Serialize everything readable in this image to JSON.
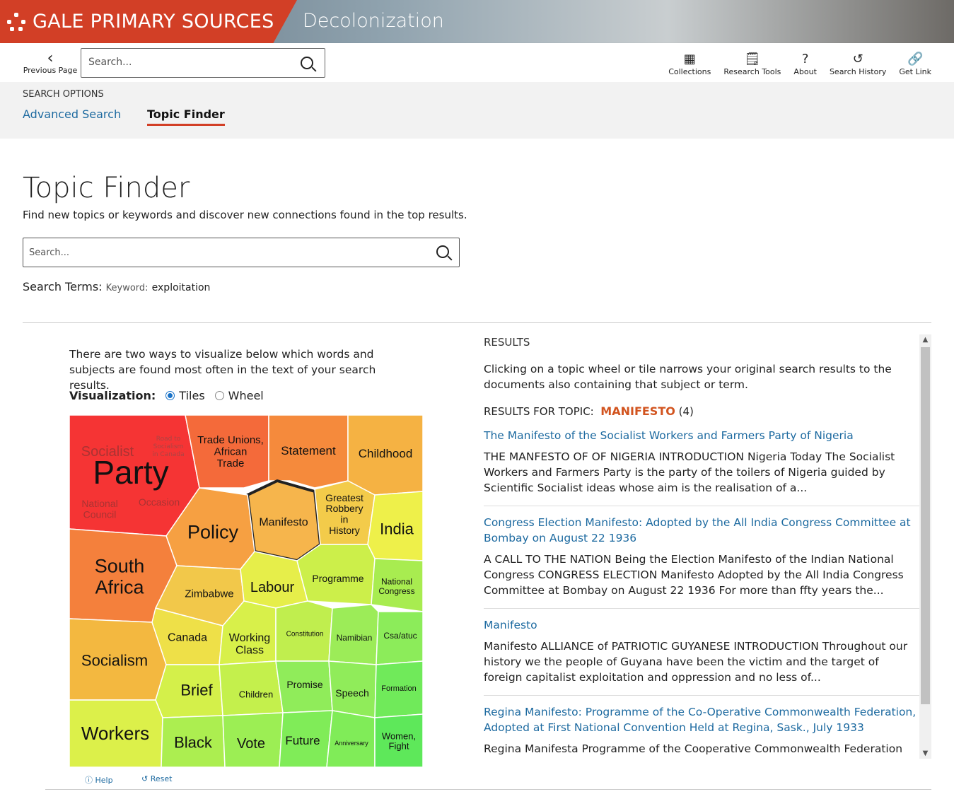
{
  "header": {
    "brand": "GALE PRIMARY SOURCES",
    "collection": "Decolonization"
  },
  "toolbar": {
    "previous": "Previous Page",
    "search_placeholder": "Search...",
    "tools": [
      {
        "label": "Collections",
        "icon": "grid-icon"
      },
      {
        "label": "Research Tools",
        "icon": "notebook-icon"
      },
      {
        "label": "About",
        "icon": "question-icon"
      },
      {
        "label": "Search History",
        "icon": "history-icon"
      },
      {
        "label": "Get Link",
        "icon": "link-icon"
      }
    ]
  },
  "search_options": {
    "label": "SEARCH OPTIONS",
    "advanced": "Advanced Search",
    "topic_finder": "Topic Finder"
  },
  "page": {
    "title": "Topic Finder",
    "subtitle": "Find new topics or keywords and discover new connections found in the top results.",
    "search_placeholder": "Search...",
    "terms_label": "Search Terms:",
    "keyword_label": "Keyword:",
    "keyword_value": "exploitation"
  },
  "viz": {
    "intro": "There are two ways to visualize below which words and subjects are found most often in the text of your search results.",
    "label": "Visualization:",
    "options": [
      "Tiles",
      "Wheel"
    ],
    "selected": "Tiles",
    "help": "Help",
    "reset": "Reset",
    "selected_tile": "Manifesto"
  },
  "tiles": [
    {
      "label": "Trade Unions, African Trade",
      "color": "#f46a3a"
    },
    {
      "label": "Statement",
      "color": "#f58a3c"
    },
    {
      "label": "Childhood",
      "color": "#f5b243"
    },
    {
      "label": "Manifesto",
      "color": "#f6b54c"
    },
    {
      "label": "Greatest Robbery in History",
      "color": "#f3cb4a"
    },
    {
      "label": "India",
      "color": "#eef04a"
    },
    {
      "label": "Policy",
      "color": "#f6a042"
    },
    {
      "label": "South Africa",
      "color": "#f4803c"
    },
    {
      "label": "Zimbabwe",
      "color": "#f2c84a"
    },
    {
      "label": "Labour",
      "color": "#e6ee4a"
    },
    {
      "label": "Programme",
      "color": "#ccef4a"
    },
    {
      "label": "National Congress",
      "color": "#a8ec50"
    },
    {
      "label": "Socialism",
      "color": "#f3b840"
    },
    {
      "label": "Canada",
      "color": "#eee048"
    },
    {
      "label": "Working Class",
      "color": "#d8f04a"
    },
    {
      "label": "Constitution",
      "color": "#c0ee4e"
    },
    {
      "label": "Namibian",
      "color": "#9cec58"
    },
    {
      "label": "Csa/atuc",
      "color": "#8cec5a"
    },
    {
      "label": "Brief",
      "color": "#d4f04a"
    },
    {
      "label": "Children",
      "color": "#c4f04c"
    },
    {
      "label": "Promise",
      "color": "#90ec5a"
    },
    {
      "label": "Speech",
      "color": "#90ec5a"
    },
    {
      "label": "Formation",
      "color": "#70ea5a"
    },
    {
      "label": "Workers",
      "color": "#dcf04a"
    },
    {
      "label": "Black",
      "color": "#acee50"
    },
    {
      "label": "Vote",
      "color": "#9cee54"
    },
    {
      "label": "Future",
      "color": "#80ec58"
    },
    {
      "label": "Anniversary",
      "color": "#80ec58"
    },
    {
      "label": "Women, Fight",
      "color": "#5ee85a"
    }
  ],
  "party_group": {
    "label": "Party",
    "color": "#f53434",
    "subtopics": [
      "Socialist",
      "Road to Socialism in Canada",
      "National Council",
      "Occasion"
    ]
  },
  "results": {
    "heading": "RESULTS",
    "intro": "Clicking on a topic wheel or tile narrows your original search results to the documents also containing that subject or term.",
    "for_topic_label": "RESULTS FOR TOPIC:",
    "topic": "MANIFESTO",
    "count": "(4)",
    "items": [
      {
        "title": "The Manifesto of the Socialist Workers and Farmers Party of Nigeria",
        "snippet": "THE MANFESTO OF OF NIGERIA INTRODUCTION Nigeria Today The Socialist Workers and Farmers Party is the party of the toilers of Nigeria guided by Scientific Socialist ideas whose aim is the realisation of a..."
      },
      {
        "title": "Congress Election Manifesto: Adopted by the All India Congress Committee at Bombay on August 22 1936",
        "snippet": "A CALL TO THE NATION Being the Election Manifesto of the Indian National Congress CONGRESS ELECTION Manifesto Adopted by the All India Congress Committee at Bombay on August 22 1936 For more than ffty years the..."
      },
      {
        "title": "Manifesto",
        "snippet": "Manifesto ALLIANCE of PATRIOTIC GUYANESE INTRODUCTION Throughout our history we the people of Guyana have been the victim and the target of foreign capitalist exploitation and oppression and no less of..."
      },
      {
        "title": "Regina Manifesto: Programme of the Co-Operative Commonwealth Federation, Adopted at First National Convention Held at Regina, Sask., July 1933",
        "snippet": "Regina Manifesta Programme of the Cooperative Commonwealth Federation"
      }
    ]
  }
}
